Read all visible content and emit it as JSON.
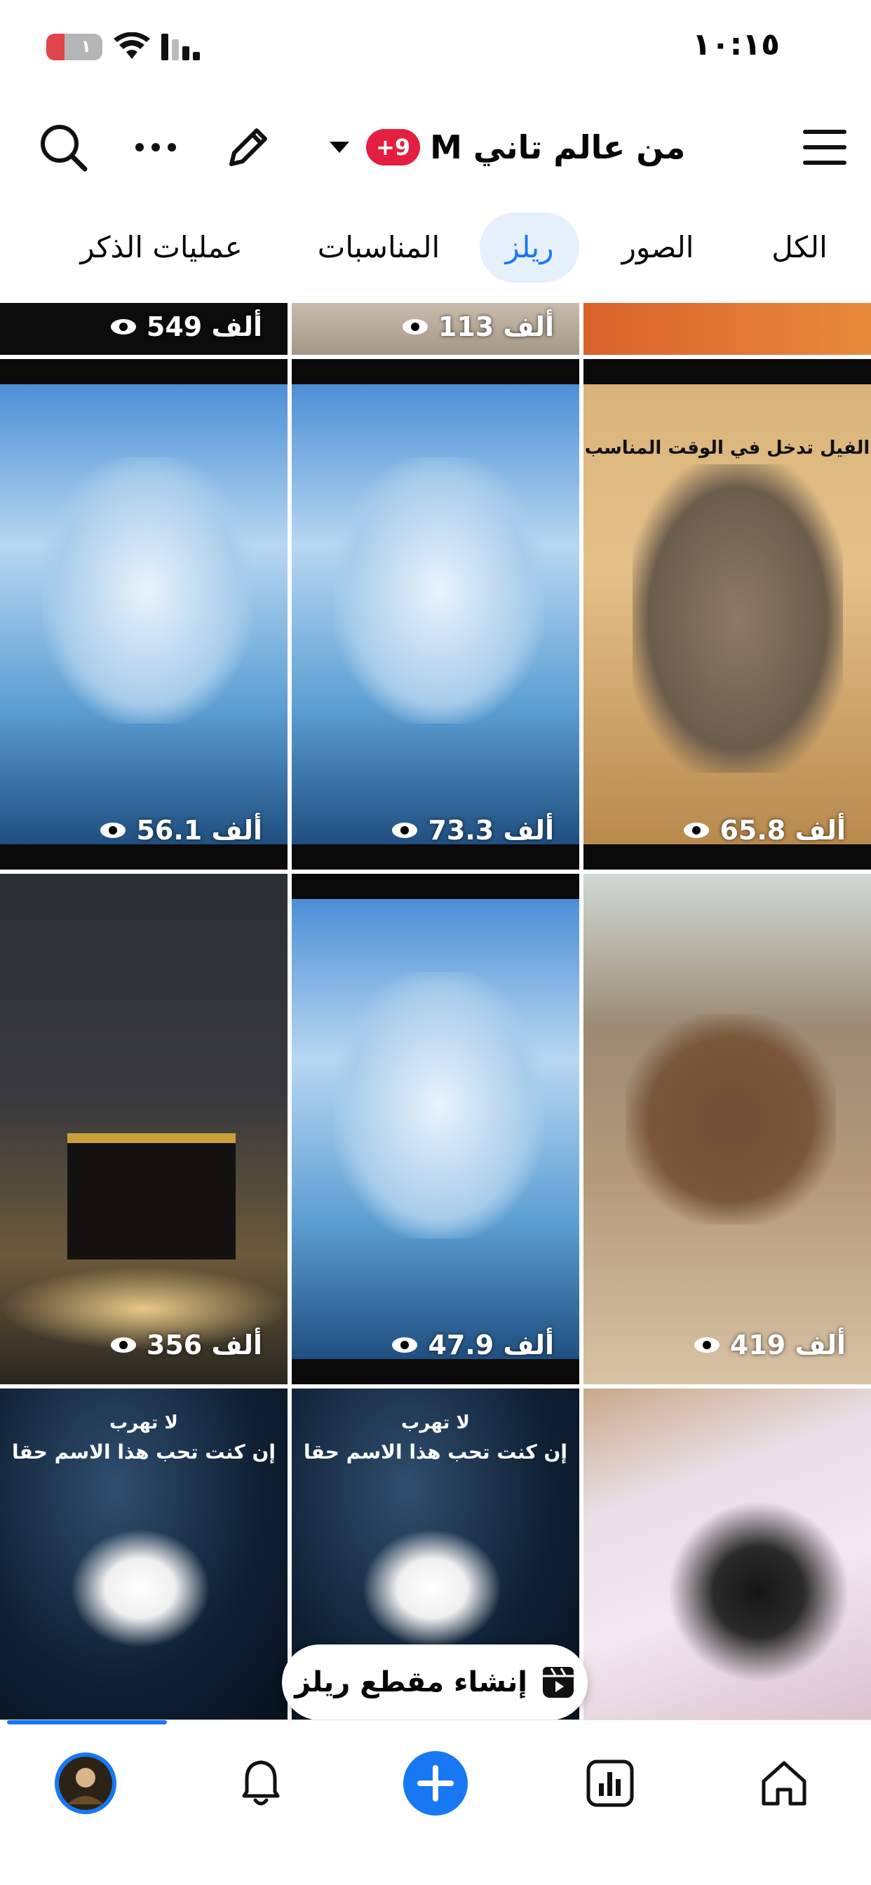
{
  "status_bar": {
    "time": "١٠:١٥",
    "battery_level": "١",
    "battery_fraction": 0.15
  },
  "header": {
    "title": "من عالم تاني M",
    "notification_badge": "9+",
    "icons": [
      "menu-icon",
      "chevron-down-icon",
      "edit-icon",
      "more-icon",
      "search-icon"
    ]
  },
  "tabs": [
    {
      "label": "الكل",
      "active": false
    },
    {
      "label": "الصور",
      "active": false
    },
    {
      "label": "ريلز",
      "active": true
    },
    {
      "label": "المناسبات",
      "active": false
    },
    {
      "label": "عمليات الذكر",
      "active": false
    }
  ],
  "reels": {
    "top_row": [
      {
        "views": "549 ألف"
      },
      {
        "views": "113 ألف"
      },
      {
        "views": ""
      }
    ],
    "row1": [
      {
        "views": "56.1 ألف",
        "caption": ""
      },
      {
        "views": "73.3 ألف",
        "caption": ""
      },
      {
        "views": "65.8 ألف",
        "caption": "الفيل تدخل في الوقت المناسب"
      }
    ],
    "row2": [
      {
        "views": "356 ألف"
      },
      {
        "views": "47.9 ألف"
      },
      {
        "views": "419 ألف"
      }
    ],
    "row3": [
      {
        "caption_line1": "لا تهرب",
        "caption_line2": "إن كنت تحب هذا الاسم حقا"
      },
      {
        "caption_line1": "لا تهرب",
        "caption_line2": "إن كنت تحب هذا الاسم حقا"
      },
      {
        "caption_line1": "",
        "caption_line2": ""
      }
    ]
  },
  "create_button": {
    "label": "إنشاء مقطع ريلز",
    "icon": "reels-icon"
  },
  "bottom_nav": [
    "profile-avatar",
    "bell-icon",
    "add-icon",
    "insights-icon",
    "home-icon"
  ],
  "colors": {
    "accent": "#1877f2",
    "badge": "#e41e3f",
    "tab_active_bg": "#e6f0fc"
  }
}
